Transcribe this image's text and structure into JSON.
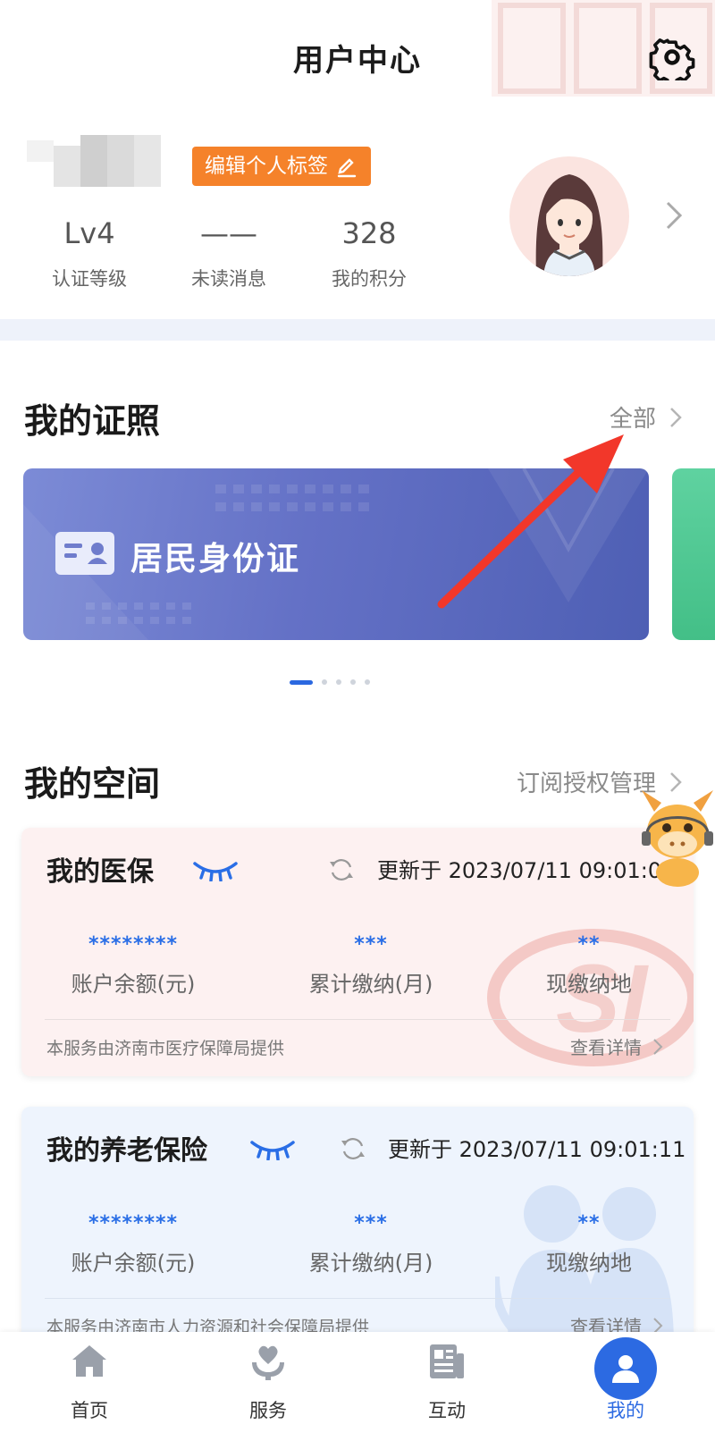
{
  "header": {
    "title": "用户中心",
    "settings_icon": "gear-icon"
  },
  "profile": {
    "edit_tag_label": "编辑个人标签",
    "stats": [
      {
        "value": "Lv4",
        "label": "认证等级"
      },
      {
        "value": "——",
        "label": "未读消息"
      },
      {
        "value": "328",
        "label": "我的积分"
      }
    ]
  },
  "licenses": {
    "title": "我的证照",
    "all_label": "全部",
    "card_label": "居民身份证",
    "page_count": 5,
    "active_page": 1
  },
  "space": {
    "title": "我的空间",
    "manage_label": "订阅授权管理",
    "medical": {
      "title": "我的医保",
      "updated": "更新于 2023/07/11 09:01:08",
      "values": [
        {
          "value": "********",
          "label": "账户余额(元)"
        },
        {
          "value": "***",
          "label": "累计缴纳(月)"
        },
        {
          "value": "**",
          "label": "现缴纳地"
        }
      ],
      "provider": "本服务由济南市医疗保障局提供",
      "detail_label": "查看详情"
    },
    "pension": {
      "title": "我的养老保险",
      "updated": "更新于 2023/07/11 09:01:11",
      "values": [
        {
          "value": "********",
          "label": "账户余额(元)"
        },
        {
          "value": "***",
          "label": "累计缴纳(月)"
        },
        {
          "value": "**",
          "label": "现缴纳地"
        }
      ],
      "provider": "本服务由济南市人力资源和社会保障局提供",
      "detail_label": "查看详情"
    }
  },
  "tabbar": {
    "tabs": [
      {
        "label": "首页",
        "icon": "home-icon"
      },
      {
        "label": "服务",
        "icon": "service-icon"
      },
      {
        "label": "互动",
        "icon": "news-icon"
      },
      {
        "label": "我的",
        "icon": "user-icon"
      }
    ],
    "active": "我的"
  },
  "colors": {
    "accent": "#2c6ae2",
    "tag_orange": "#f5822a",
    "arrow_red": "#f2372a"
  }
}
